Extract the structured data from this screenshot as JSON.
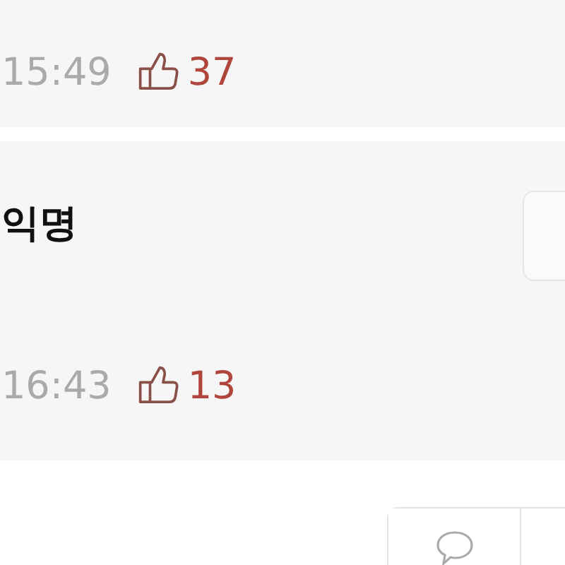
{
  "comments": [
    {
      "time": "15:49",
      "likes": "37"
    },
    {
      "author": "익명",
      "time": "16:43",
      "likes": "13"
    }
  ]
}
